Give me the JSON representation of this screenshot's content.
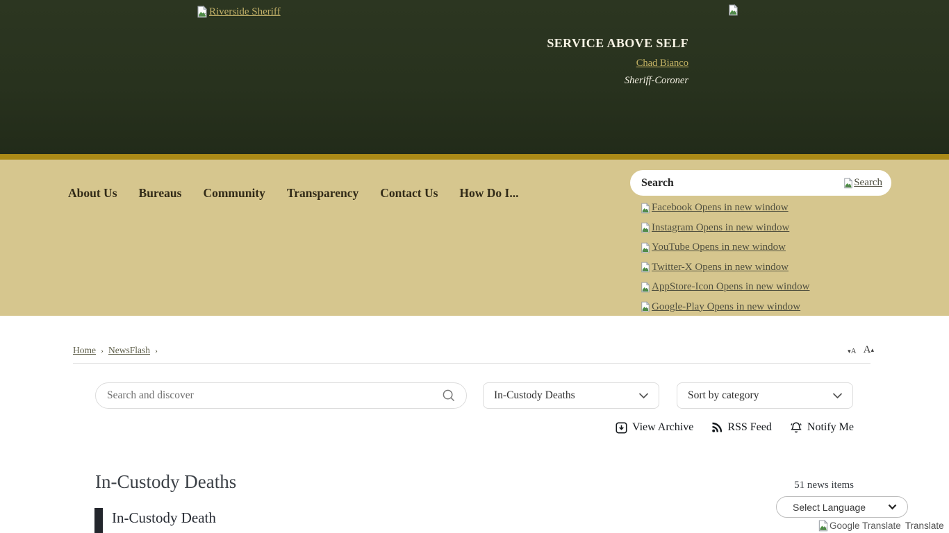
{
  "colors": {
    "header_green": "#28321e",
    "gold_stripe": "#ab8a17",
    "tan_band": "#d6c68e",
    "header_link_gold": "#bfae67"
  },
  "header": {
    "logo_alt": "Riverside Sheriff",
    "motto": "SERVICE ABOVE SELF",
    "sheriff_name": "Chad Bianco",
    "sheriff_title": "Sheriff-Coroner"
  },
  "nav": {
    "items": [
      "About Us",
      "Bureaus",
      "Community",
      "Transparency",
      "Contact Us",
      "How Do I..."
    ]
  },
  "header_search": {
    "placeholder": "Search",
    "submit_label": "Search"
  },
  "social": {
    "links": [
      {
        "label": "Facebook Opens in new window"
      },
      {
        "label": "Instagram Opens in new window"
      },
      {
        "label": "YouTube Opens in new window"
      },
      {
        "label": "Twitter-X Opens in new window"
      },
      {
        "label": "AppStore-Icon Opens in new window"
      },
      {
        "label": "Google-Play Opens in new window"
      }
    ]
  },
  "breadcrumb": {
    "home": "Home",
    "separator": "›",
    "newsflash": "NewsFlash"
  },
  "text_size": {
    "decrease_icon": "▾",
    "decrease_label": "A",
    "increase_label": "A",
    "increase_icon": "▴"
  },
  "filters": {
    "search_placeholder": "Search and discover",
    "category_value": "In-Custody Deaths",
    "sort_value": "Sort by category"
  },
  "actions": {
    "view_archive": "View Archive",
    "rss_feed": "RSS Feed",
    "notify_me": "Notify Me"
  },
  "content": {
    "title": "In-Custody Deaths",
    "count": "51 news items",
    "language_value": "Select Language",
    "translate_alt": "Google Translate",
    "translate_label": "Translate",
    "item_title": "In-Custody Death"
  }
}
